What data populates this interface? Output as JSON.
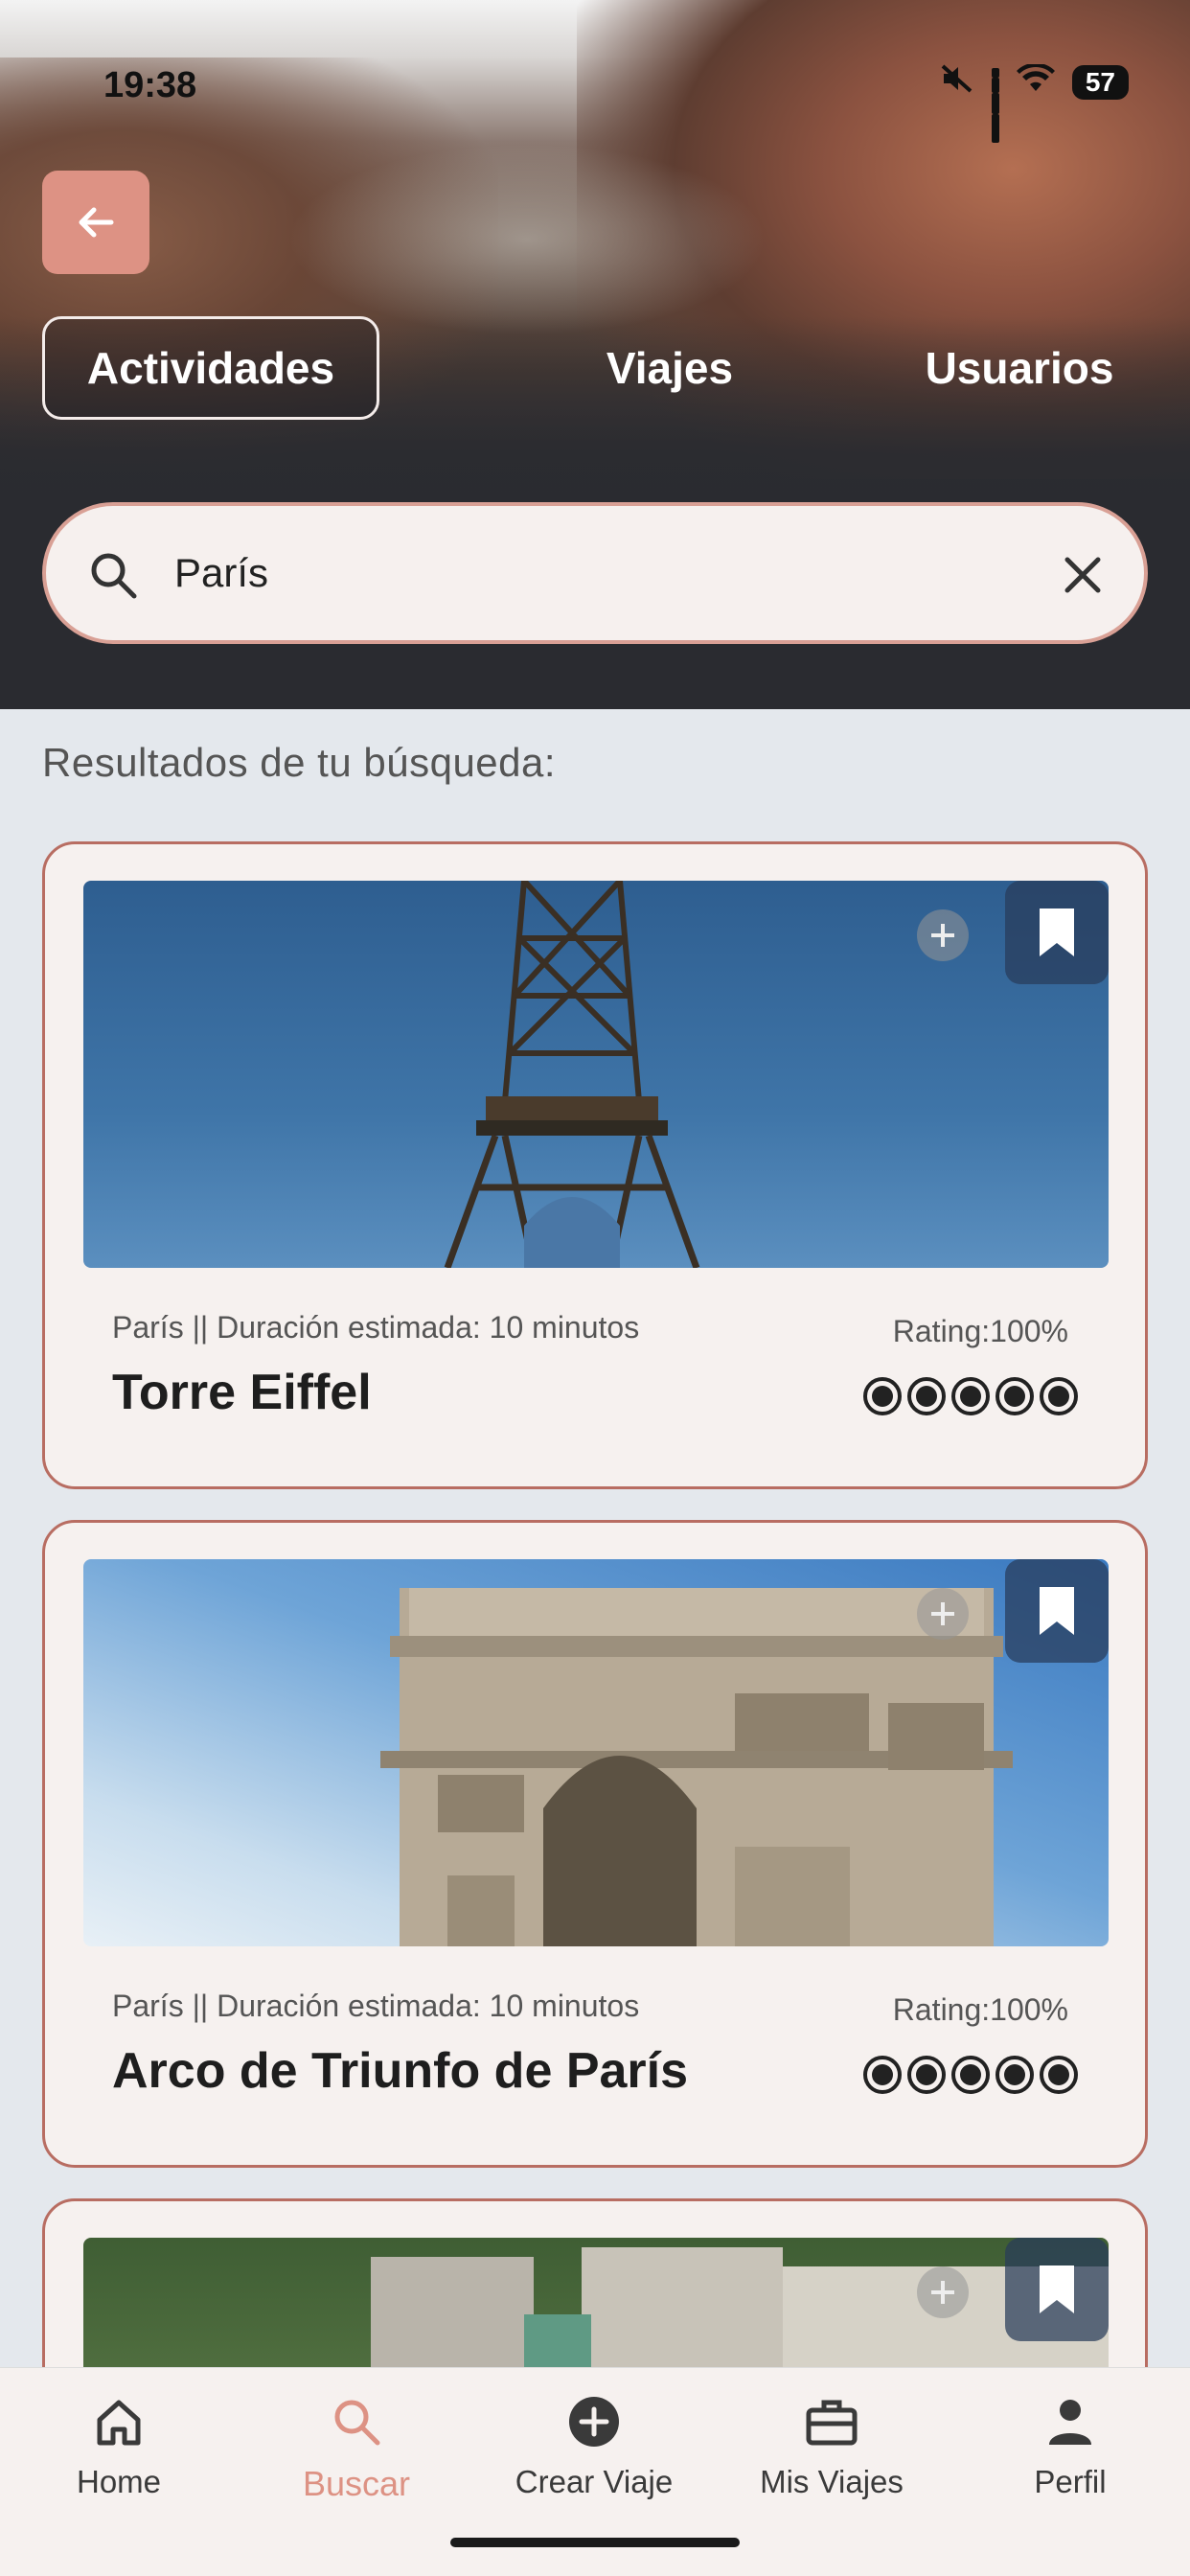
{
  "status_bar": {
    "time": "19:38",
    "battery": "57"
  },
  "header": {
    "tabs": [
      {
        "label": "Actividades",
        "active": true
      },
      {
        "label": "Viajes",
        "active": false
      },
      {
        "label": "Usuarios",
        "active": false
      }
    ],
    "search": {
      "value": "París",
      "placeholder": ""
    }
  },
  "results": {
    "title": "Resultados de tu búsqueda:",
    "items": [
      {
        "meta": "París || Duración estimada: 10 minutos",
        "title": "Torre Eiffel",
        "rating": "Rating:100%",
        "stars": 5
      },
      {
        "meta": "París || Duración estimada: 10 minutos",
        "title": "Arco de Triunfo de París",
        "rating": "Rating:100%",
        "stars": 5
      },
      {
        "meta": "",
        "title": "",
        "rating": "",
        "stars": 0
      }
    ]
  },
  "nav": [
    {
      "label": "Home",
      "icon": "home-icon"
    },
    {
      "label": "Buscar",
      "icon": "search-icon",
      "active": true
    },
    {
      "label": "Crear Viaje",
      "icon": "add-circle-icon"
    },
    {
      "label": "Mis Viajes",
      "icon": "briefcase-icon"
    },
    {
      "label": "Perfil",
      "icon": "person-icon"
    }
  ],
  "colors": {
    "accent": "#dd9284",
    "card_border": "#b86d62",
    "card_bg": "#f6f1ef",
    "page_bg": "#e4e8ed",
    "header_bg": "#2a2b30"
  }
}
